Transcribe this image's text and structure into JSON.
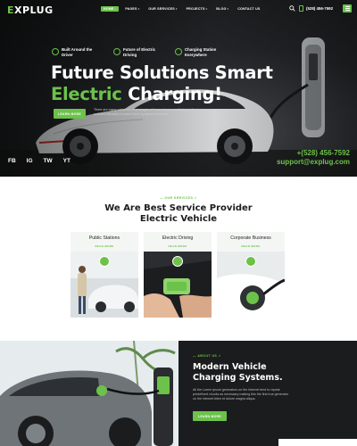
{
  "header": {
    "logo_prefix": "E",
    "logo_rest": "XPLUG",
    "menu": [
      {
        "label": "HOME",
        "active": true,
        "has_dropdown": true
      },
      {
        "label": "PAGES",
        "active": false,
        "has_dropdown": true
      },
      {
        "label": "OUR SERVICES",
        "active": false,
        "has_dropdown": true
      },
      {
        "label": "PROJECTS",
        "active": false,
        "has_dropdown": true
      },
      {
        "label": "BLOG",
        "active": false,
        "has_dropdown": true
      },
      {
        "label": "CONTACT US",
        "active": false,
        "has_dropdown": false
      }
    ],
    "phone": "(528) 456-7592",
    "icons": {
      "search": "search-icon",
      "phone": "phone-icon",
      "menu": "hamburger-menu-icon"
    }
  },
  "hero": {
    "features": [
      {
        "text": "Built Around the Driver",
        "icon": "steering-wheel-icon"
      },
      {
        "text": "Future of Electric Driving",
        "icon": "electric-plug-icon"
      },
      {
        "text": "Charging Station Everywhere",
        "icon": "charging-station-icon"
      }
    ],
    "title_line1": "Future Solutions Smart",
    "title_line2_accent": "Electric",
    "title_line2_rest": " Charging!",
    "button_label": "LEARN MORE",
    "description": "There are many variations of passages of Lorem Ipsum available but the have suffered alteration in some form, by injected humour.",
    "social": [
      "FB",
      "IG",
      "TW",
      "YT"
    ],
    "contact_phone": "+(528) 456-7592",
    "contact_email": "support@explug.com"
  },
  "services": {
    "tag": "OUR SERVICES",
    "title_line1": "We Are Best Service Provider",
    "title_line2": "Electric Vehicle",
    "cards": [
      {
        "title": "Public Stations",
        "link": "READ MORE"
      },
      {
        "title": "Electric Driving",
        "link": "READ MORE"
      },
      {
        "title": "Corporate Business",
        "link": "READ MORE"
      }
    ]
  },
  "about": {
    "tag": "ABOUT US",
    "title_line1": "Modern Vehicle",
    "title_line2": "Charging Systems.",
    "description": "All the Lorem Ipsum generators on the Internet tend to repeat predefined chunks as necessary making this the first true generator on the Internet biten et dolore magna aliqua.",
    "button_label": "LEARN MORE"
  },
  "colors": {
    "accent": "#6cc24a",
    "dark": "#1b1c1d",
    "text": "#1d1d1d"
  }
}
